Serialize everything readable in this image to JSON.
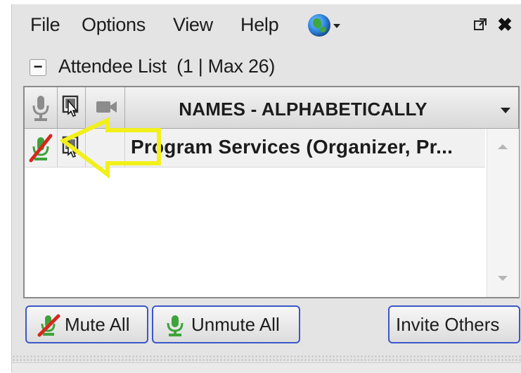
{
  "menu": {
    "file": "File",
    "options": "Options",
    "view": "View",
    "help": "Help",
    "globe_icon": "globe-icon",
    "popout_icon": "popout-icon",
    "close_glyph": "✖"
  },
  "attendee_list": {
    "collapse_glyph": "−",
    "title": "Attendee List",
    "count": "(1 | Max 26)"
  },
  "table": {
    "columns": {
      "mic_icon": "microphone-icon",
      "screen_icon": "screen-share-icon",
      "camera_icon": "camera-icon",
      "names_header": "NAMES - ALPHABETICALLY"
    },
    "rows": [
      {
        "mic_state": "muted",
        "screen_icon": "presenter-icon",
        "name": "Program Services (Organizer, Pr..."
      }
    ]
  },
  "buttons": {
    "mute_all": "Mute All",
    "unmute_all": "Unmute All",
    "invite_others": "Invite Others"
  },
  "colors": {
    "button_border": "#3b57c9",
    "annotation_arrow": "#f2f01a",
    "mic_green": "#3ea33a",
    "mute_slash": "#d4281c"
  }
}
